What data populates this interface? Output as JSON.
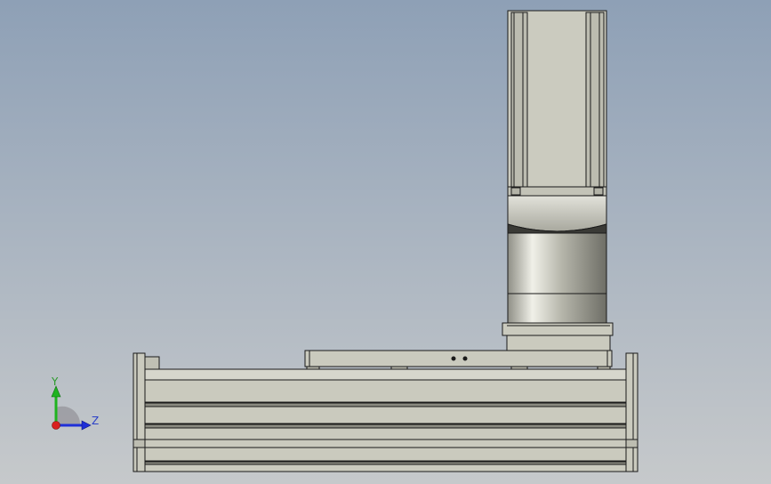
{
  "triad": {
    "y_label": "Y",
    "z_label": "Z",
    "colors": {
      "y": "#1fb31f",
      "z": "#1f2fd8",
      "x": "#d81f1f"
    }
  },
  "colors": {
    "background_top": "#8ea0b6",
    "background_bottom": "#c6c9cb",
    "part_fill": "#c8c8bc",
    "part_edge": "#1a1a1a"
  }
}
